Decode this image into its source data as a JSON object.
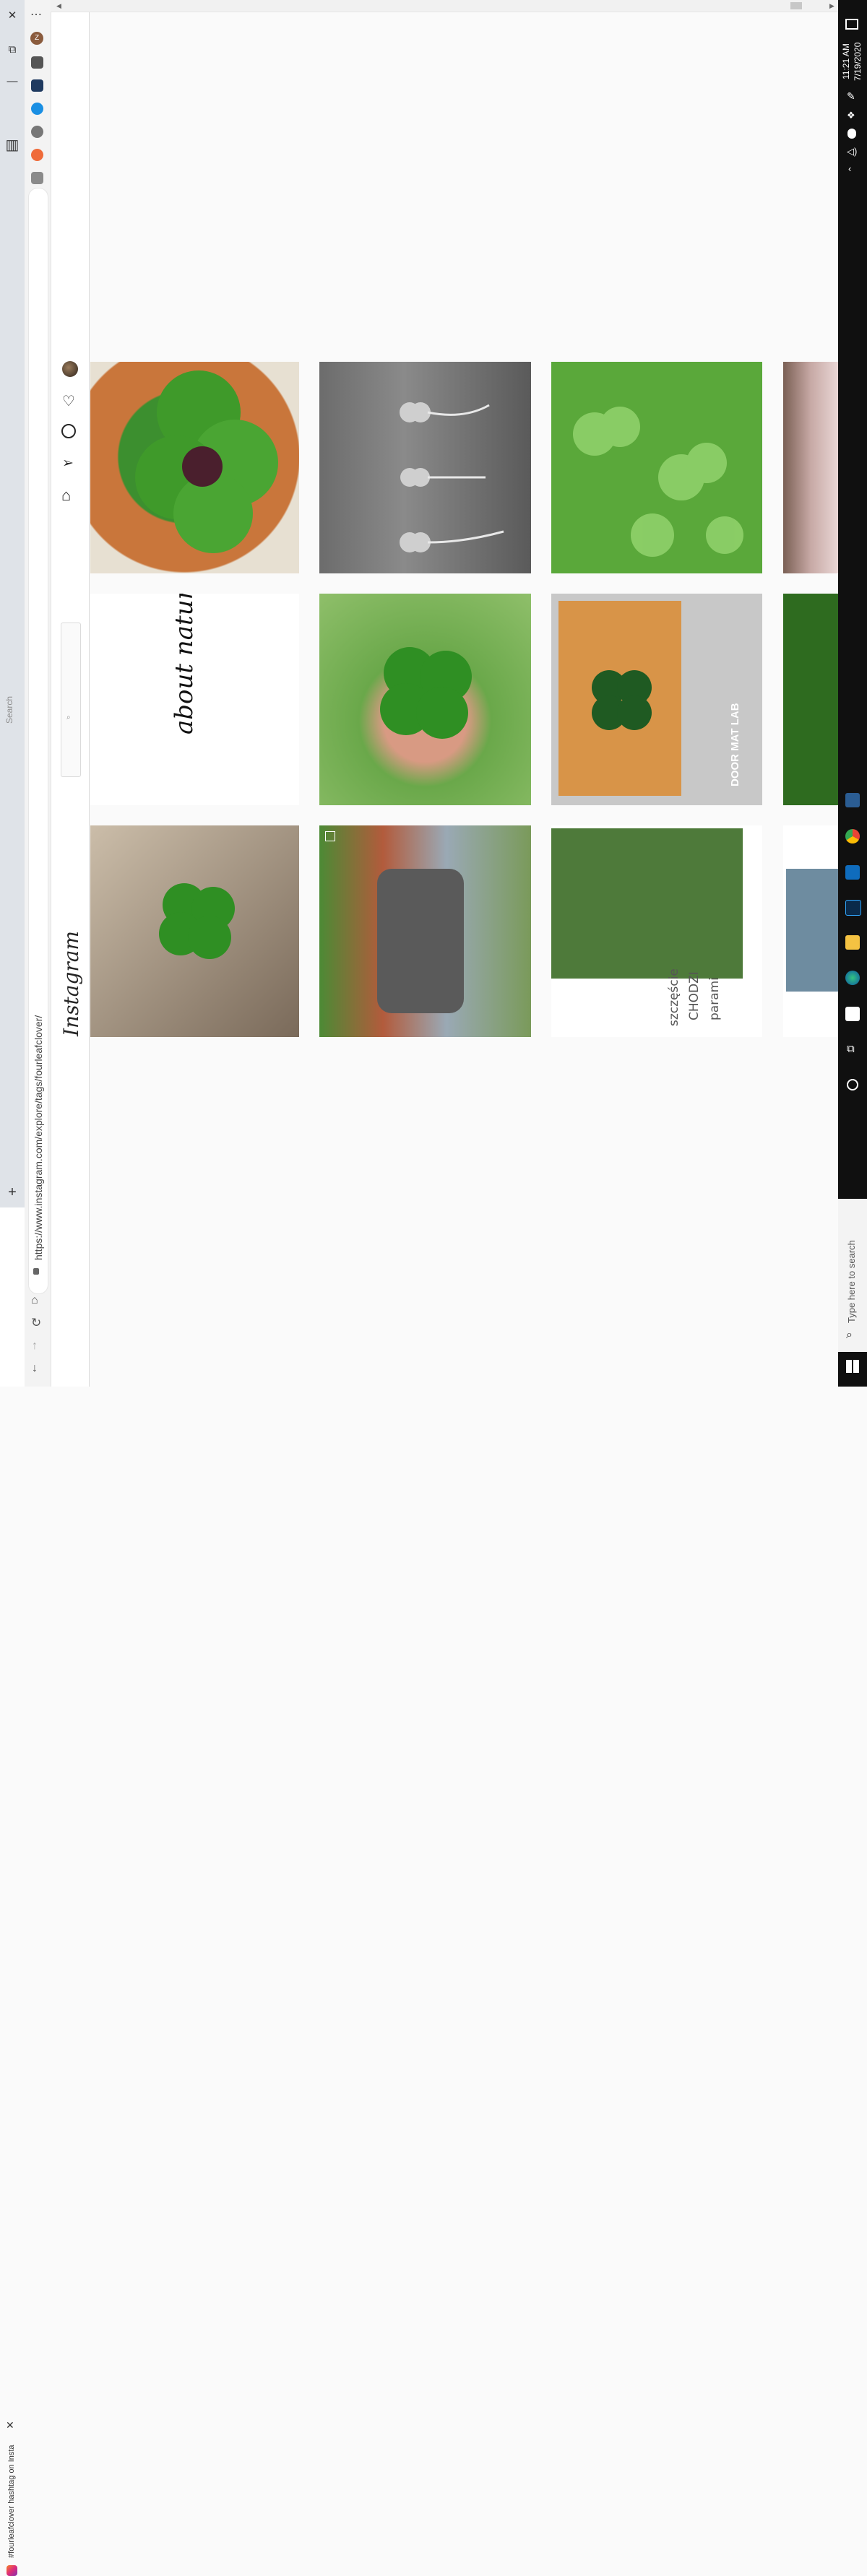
{
  "browser": {
    "tab_title": "#fourleafclover hashtag on Insta",
    "url": "https://www.instagram.com/explore/tags/fourleafclover/",
    "profile_initial": "Z"
  },
  "instagram": {
    "logo": "Instagram",
    "search_placeholder": "Search"
  },
  "posts": [
    {
      "row": 1,
      "col": 1,
      "subject": "four-leaf clover with dark center in a clay pot"
    },
    {
      "row": 1,
      "col": 2,
      "subject": "black and white clovers on wood"
    },
    {
      "row": 1,
      "col": 3,
      "subject": "green clover patch in grass"
    },
    {
      "row": 1,
      "col": 4,
      "subject": "cherry blossom tree (partially visible)"
    },
    {
      "row": 2,
      "col": 1,
      "subject": "about nature logo",
      "text": "about nature"
    },
    {
      "row": 2,
      "col": 2,
      "subject": "hand holding four-leaf clover"
    },
    {
      "row": 2,
      "col": 3,
      "subject": "doormat with clover print",
      "text": "DOOR MAT LAB"
    },
    {
      "row": 2,
      "col": 4,
      "subject": "clover leaves (partially visible)"
    },
    {
      "row": 3,
      "col": 1,
      "subject": "fingers holding four-leaf clover"
    },
    {
      "row": 3,
      "col": 2,
      "subject": "man with mask holding peaches in garden"
    },
    {
      "row": 3,
      "col": 3,
      "subject": "hand picking clover",
      "text_lines": [
        "szczęście",
        "CHODZI",
        "parami"
      ]
    },
    {
      "row": 3,
      "col": 4,
      "subject": "child portrait (partially visible)"
    }
  ],
  "taskbar": {
    "time": "11:21 AM",
    "date": "7/19/2020",
    "search_placeholder": "Type here to search"
  },
  "colors": {
    "clover_green": "#3f9a2a",
    "taskbar_bg": "#101010",
    "instagram_bg": "#fafafa"
  }
}
